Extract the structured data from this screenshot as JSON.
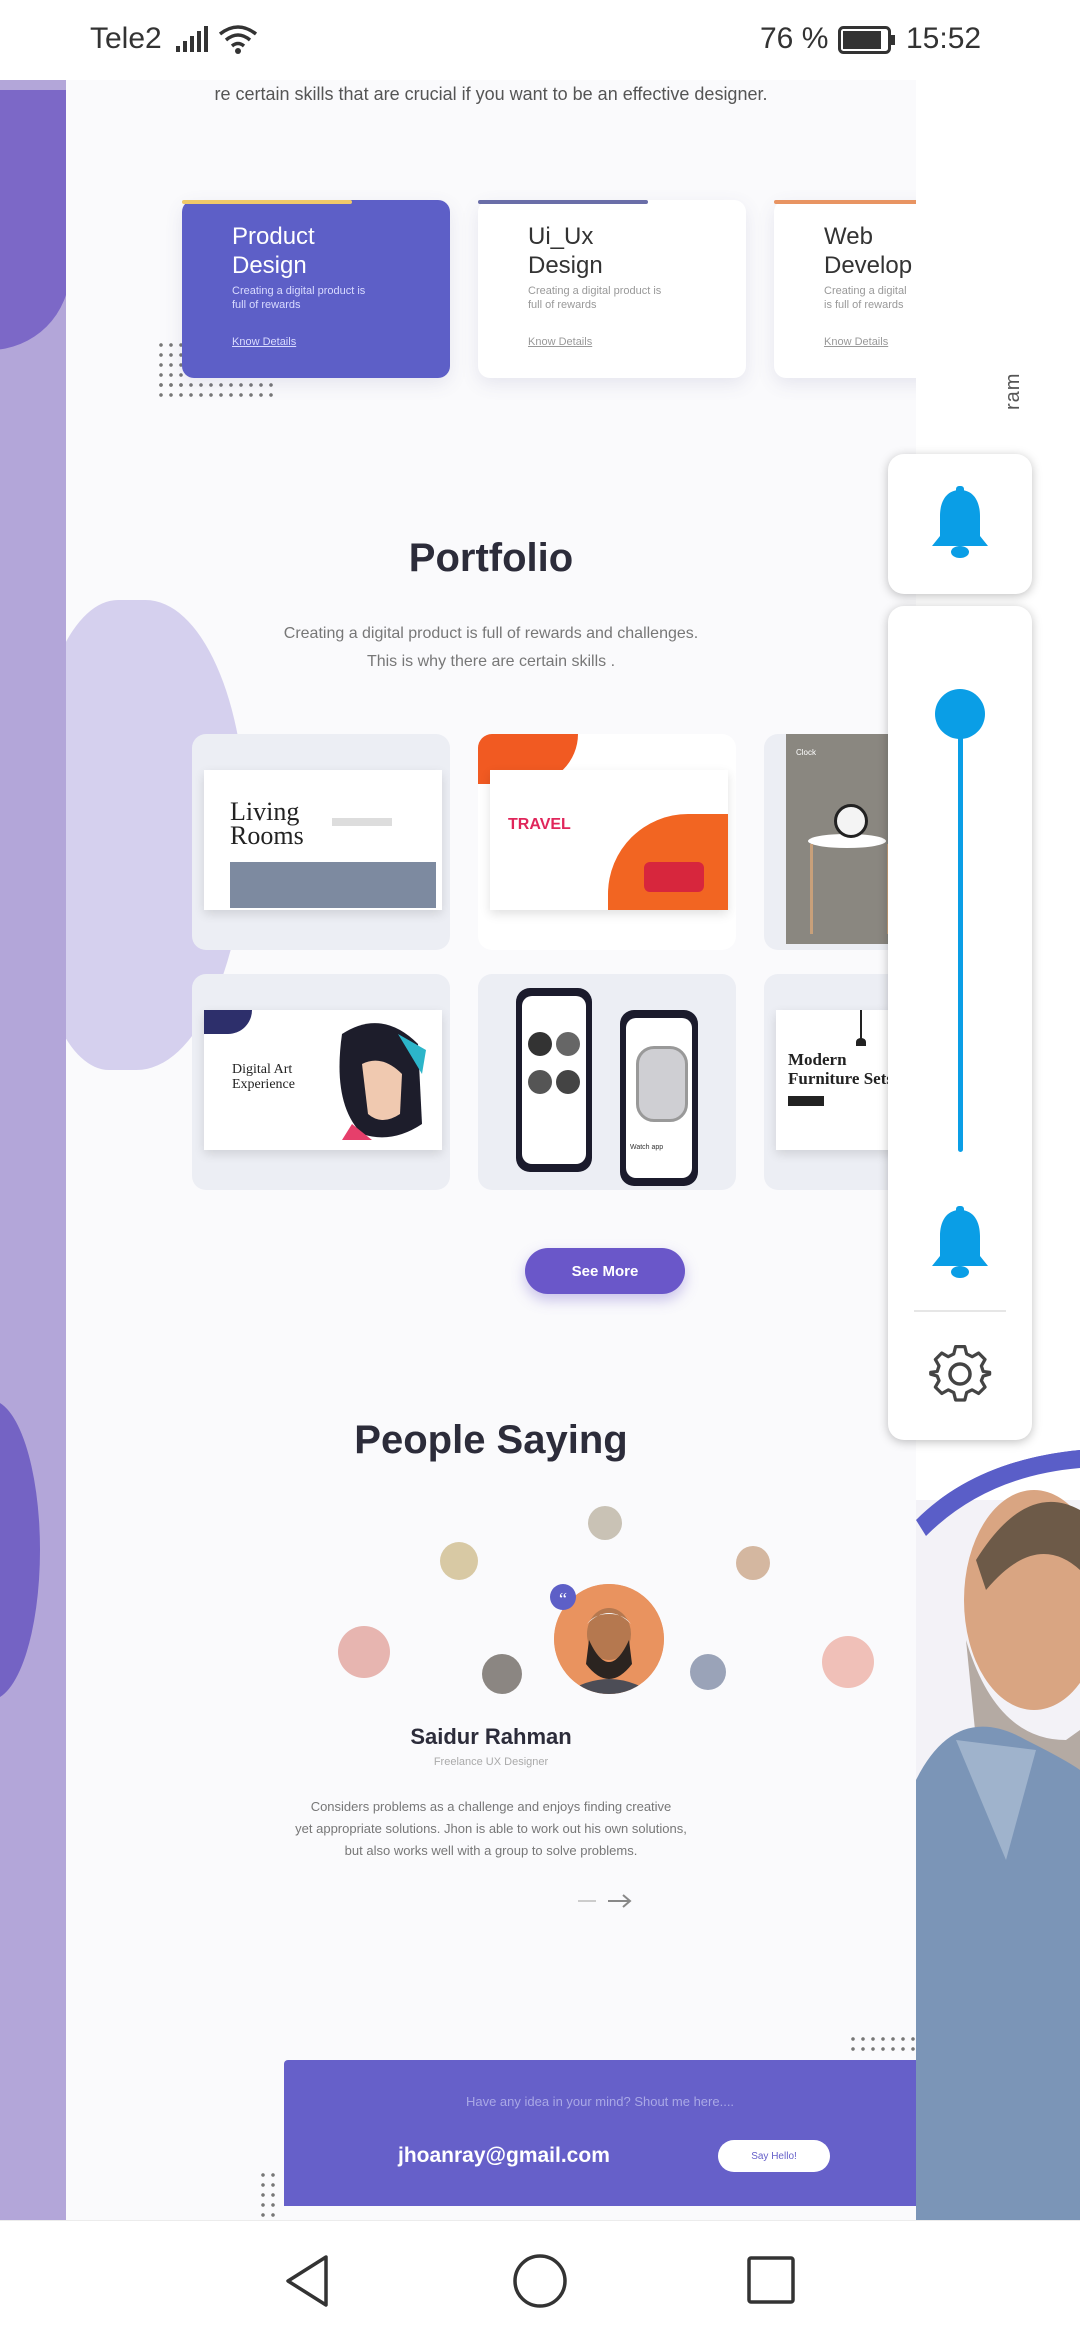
{
  "status_bar": {
    "carrier": "Tele2",
    "battery": "76 %",
    "time": "15:52"
  },
  "intro_text": "re certain skills that  are crucial if you want to be an effective designer.",
  "services": [
    {
      "title": "Product Design",
      "desc": "Creating a digital product is full of rewards",
      "link": "Know Details"
    },
    {
      "title": "Ui_Ux Design",
      "desc": "Creating a digital product is full of rewards",
      "link": "Know Details"
    },
    {
      "title": "Web Develop",
      "desc": "Creating a digital is full of rewards",
      "link": "Know Details"
    }
  ],
  "portfolio": {
    "title": "Portfolio",
    "subtitle_line1": "Creating a digital product is full of rewards and challenges.",
    "subtitle_line2": "This is why there are certain skills .",
    "items": [
      {
        "name": "Living Rooms"
      },
      {
        "name": "TRAVEL"
      },
      {
        "name": "Clock"
      },
      {
        "name": "Digital Art Experience"
      },
      {
        "name": "Watch app"
      },
      {
        "name": "Modern Furniture Sets"
      }
    ],
    "button": "See More"
  },
  "testimonials": {
    "title": "People Saying",
    "name": "Saidur Rahman",
    "role": "Freelance UX Designer",
    "quote_line1": "Considers problems as a challenge and enjoys finding creative",
    "quote_line2": "yet appropriate solutions. Jhon is able to work out his own solutions,",
    "quote_line3": "but also works well with a group to solve problems."
  },
  "contact": {
    "prompt": "Have any idea in your mind? Shout me here....",
    "email": "jhoanray@gmail.com",
    "button": "Say Hello!"
  },
  "side_text": "ram",
  "volume_panel": {
    "level": 0.96
  },
  "colors": {
    "accent": "#5d5fc7",
    "slider": "#0a9ee6",
    "purple": "#6a57c9"
  }
}
